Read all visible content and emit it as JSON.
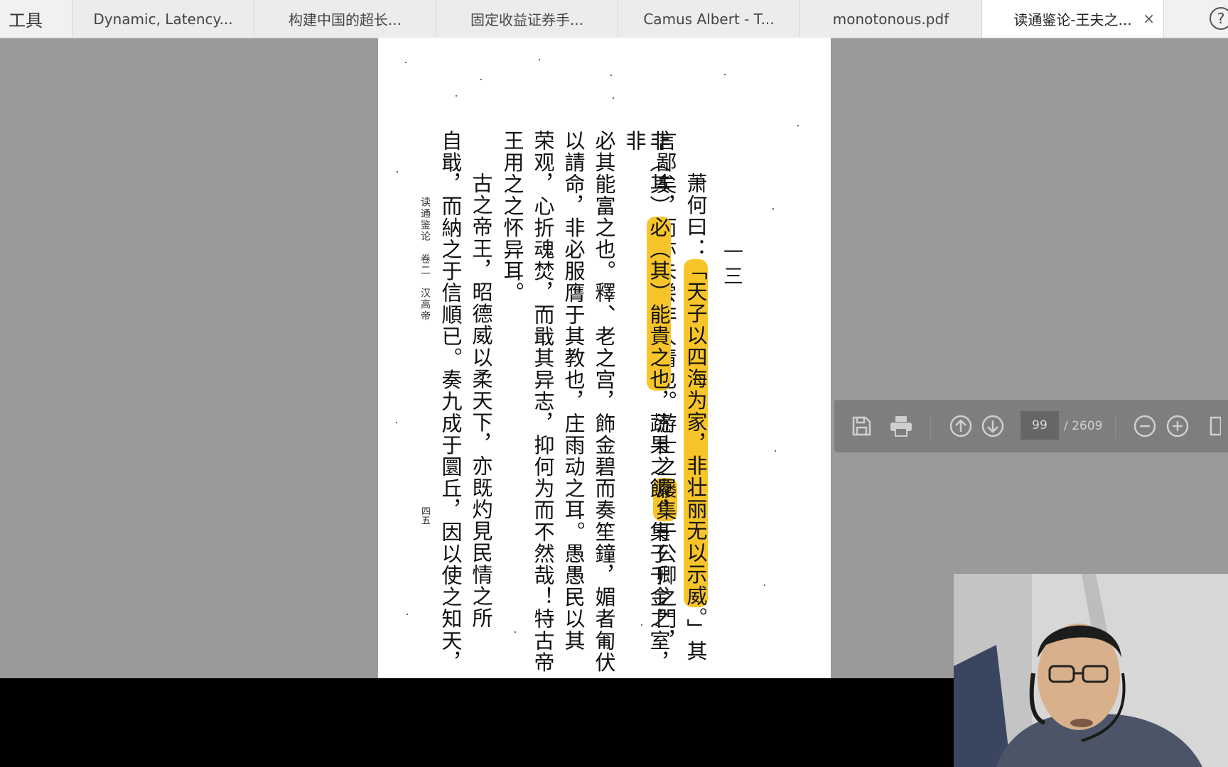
{
  "toolbar_title": "工具",
  "tabs": [
    {
      "label": "Dynamic, Latency..."
    },
    {
      "label": "构建中国的超长..."
    },
    {
      "label": "固定收益证券手..."
    },
    {
      "label": "Camus Albert - T..."
    },
    {
      "label": "monotonous.pdf"
    },
    {
      "label": "读通鉴论-王夫之...",
      "active": true,
      "close": "×"
    }
  ],
  "help_label": "?",
  "page": {
    "page_number_label": "一三",
    "running_head": "读通鉴论　卷二　汉高帝",
    "folio": "四五",
    "columns": [
      {
        "pre": "萧何曰：",
        "hl": "「天子以四海为家，非壮丽无以示威",
        "post": "。」其"
      },
      {
        "pre": "言鄙矣，而亦未尝非人情也。游士之",
        "hl": "屦集",
        "post": "于公卿之門，"
      },
      {
        "pre": "非（其）",
        "hl": "必（其）能貴之也",
        "post": "，蔬果之饋，集于千金之室，非"
      },
      {
        "pre": "必其能富之也。釋、老之宫，飾金碧而奏笙鐘，媚者匍伏",
        "hl": "",
        "post": ""
      },
      {
        "pre": "以請命，非必服膺于其教也，庄雨动之耳。愚愚民以其",
        "hl": "",
        "post": ""
      },
      {
        "pre": "荣观，心折魂焚，而戢其异志，抑何为而不然哉！特古帝",
        "hl": "",
        "post": ""
      },
      {
        "pre": "王用之之怀异耳。",
        "hl": "",
        "post": ""
      },
      {
        "pre": "古之帝王，昭德威以柔天下，亦既灼見民情之所",
        "hl": "",
        "post": ""
      },
      {
        "pre": "自戢，而納之于信順已。奏九成于圜丘，因以使之知天，",
        "hl": "",
        "post": ""
      }
    ]
  },
  "viewer_toolbar": {
    "save_icon": "save-icon",
    "print_icon": "print-icon",
    "prev_icon": "arrow-up-icon",
    "next_icon": "arrow-down-icon",
    "current_page": "99",
    "total_pages": "/ 2609",
    "zoom_out_icon": "zoom-out-icon",
    "zoom_in_icon": "zoom-in-icon",
    "colors": {
      "bar": "#7e7e7e",
      "highlight": "#f7c52a"
    }
  }
}
